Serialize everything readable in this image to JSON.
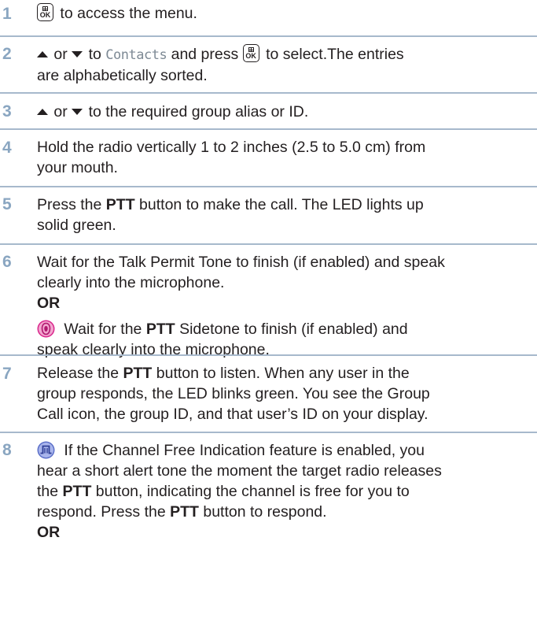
{
  "steps": [
    {
      "number": "1",
      "parts": {
        "after_key": " to access the menu."
      }
    },
    {
      "number": "2",
      "parts": {
        "or1": " or ",
        "to": " to ",
        "contacts": "Contacts",
        "press": " and press ",
        "select": " to select.The entries",
        "line2": "are alphabetically sorted."
      }
    },
    {
      "number": "3",
      "parts": {
        "or1": " or ",
        "rest": " to the required group alias or ID."
      }
    },
    {
      "number": "4",
      "parts": {
        "line1": "Hold the radio vertically 1 to 2 inches (2.5 to 5.0 cm) from",
        "line2": "your mouth."
      }
    },
    {
      "number": "5",
      "parts": {
        "pre": "Press the ",
        "ptt": "PTT",
        "post": " button to make the call. The LED lights up",
        "line2": "solid green."
      }
    },
    {
      "number": "6",
      "parts": {
        "line1": "Wait for the Talk Permit Tone to finish (if enabled) and speak",
        "line2": "clearly into the microphone.",
        "or": "OR",
        "alt_pre": " Wait for the ",
        "alt_ptt": "PTT",
        "alt_post": " Sidetone to finish (if enabled) and",
        "alt_line2": "speak clearly into the microphone."
      }
    },
    {
      "number": "7",
      "parts": {
        "pre": "Release the ",
        "ptt": "PTT",
        "post": " button to listen. When any user in the",
        "line2": "group responds, the LED blinks green. You see the Group",
        "line3": "Call icon, the group ID, and that user’s ID on your display."
      }
    },
    {
      "number": "8",
      "parts": {
        "line1": " If the Channel Free Indication feature is enabled, you",
        "line2": "hear a short alert tone the moment the target radio releases",
        "line3_pre": "the ",
        "line3_ptt": "PTT",
        "line3_post": " button, indicating the channel is free for you to",
        "line4_pre": "respond. Press the ",
        "line4_ptt": "PTT",
        "line4_post": " button to respond.",
        "or": "OR"
      }
    }
  ],
  "icons": {
    "menu_ok_key": "menu-ok-key-icon",
    "up": "up-arrow-icon",
    "down": "down-arrow-icon",
    "sidetone": "ptt-sidetone-icon",
    "channel_free": "channel-free-icon"
  },
  "key_label": "OK",
  "colors": {
    "step_number": "#8aa6c1",
    "rule": "#a7b9cc",
    "sidetone": "#d9268c",
    "channel_free": "#5b6fc8"
  }
}
